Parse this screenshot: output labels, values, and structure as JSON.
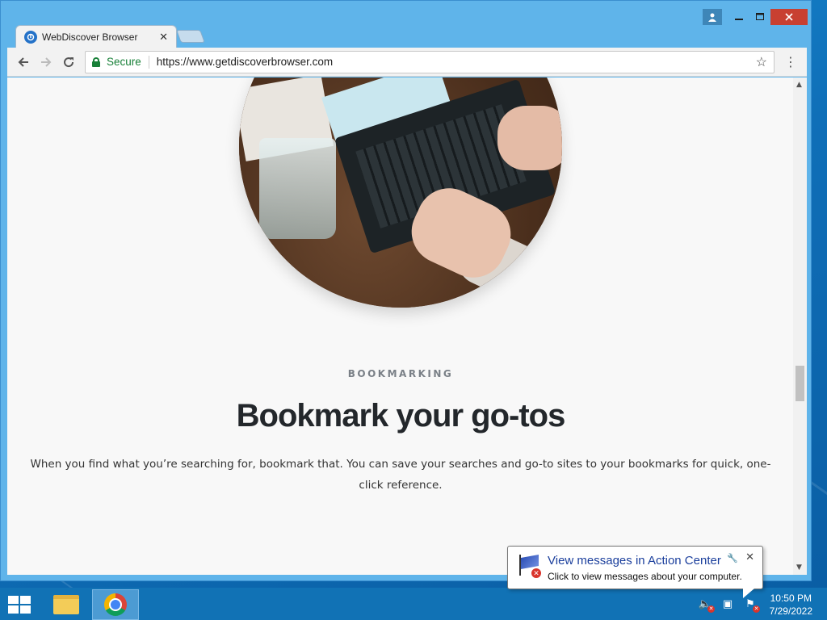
{
  "browser": {
    "tab_title": "WebDiscover Browser",
    "tab_close": "✕",
    "secure_label": "Secure",
    "url": "https://www.getdiscoverbrowser.com"
  },
  "page": {
    "eyebrow": "BOOKMARKING",
    "headline": "Bookmark your go-tos",
    "body": "When you find what you’re searching for, bookmark that. You can save your searches and go-to sites to your bookmarks for quick, one-click reference."
  },
  "notification": {
    "title": "View messages in Action Center",
    "text": "Click to view messages about your computer."
  },
  "taskbar": {
    "time": "10:50 PM",
    "date": "7/29/2022"
  },
  "icons": {
    "back": "back-arrow-icon",
    "forward": "forward-arrow-icon",
    "reload": "reload-icon",
    "secure": "lock-icon",
    "star": "star-icon",
    "menu": "menu-dots-icon"
  }
}
